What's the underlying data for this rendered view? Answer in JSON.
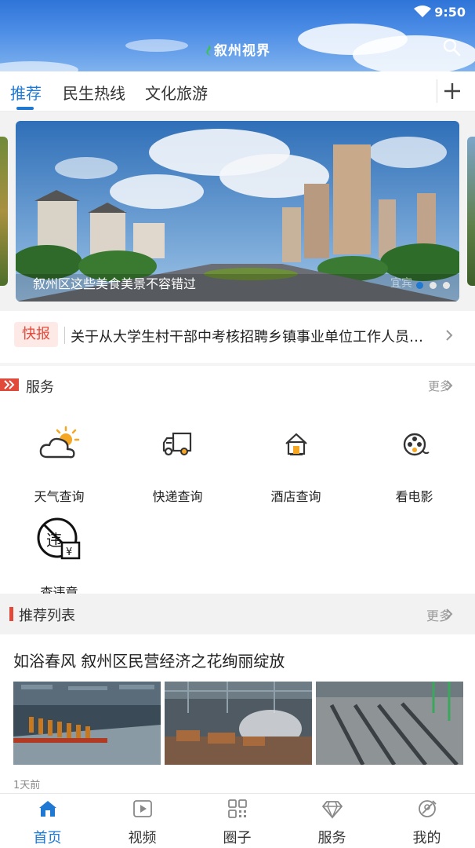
{
  "status": {
    "time": "9:50"
  },
  "header": {
    "logo_text": "叙州视界"
  },
  "tabs": [
    {
      "label": "推荐",
      "active": true
    },
    {
      "label": "民生热线",
      "active": false
    },
    {
      "label": "文化旅游",
      "active": false
    }
  ],
  "banner": {
    "caption": "叙州区这些美食美景不容错过",
    "watermark": "宜宾",
    "slide_count": 3,
    "active_slide": 1
  },
  "flash": {
    "tag": "快报",
    "text": "关于从大学生村干部中考核招聘乡镇事业单位工作人员的公告"
  },
  "services": {
    "title": "服务",
    "more": "更多",
    "items": [
      {
        "label": "天气查询",
        "icon": "weather-icon"
      },
      {
        "label": "快递查询",
        "icon": "delivery-truck-icon"
      },
      {
        "label": "酒店查询",
        "icon": "hotel-icon"
      },
      {
        "label": "看电影",
        "icon": "film-reel-icon"
      },
      {
        "label": "查违章",
        "icon": "traffic-violation-icon"
      }
    ]
  },
  "recommend": {
    "title": "推荐列表",
    "more": "更多",
    "articles": [
      {
        "title": "如浴春风 叙州区民营经济之花绚丽绽放",
        "time": "1天前",
        "images": [
          "factory-bottling-line",
          "factory-workshop-steam",
          "factory-warehouse"
        ]
      }
    ]
  },
  "bottom_nav": [
    {
      "label": "首页",
      "icon": "home-icon",
      "active": true
    },
    {
      "label": "视频",
      "icon": "video-play-icon",
      "active": false
    },
    {
      "label": "圈子",
      "icon": "grid-apps-icon",
      "active": false
    },
    {
      "label": "服务",
      "icon": "diamond-icon",
      "active": false
    },
    {
      "label": "我的",
      "icon": "profile-icon",
      "active": false
    }
  ],
  "colors": {
    "accent": "#1f78d1",
    "flash_red": "#e14a3b"
  }
}
